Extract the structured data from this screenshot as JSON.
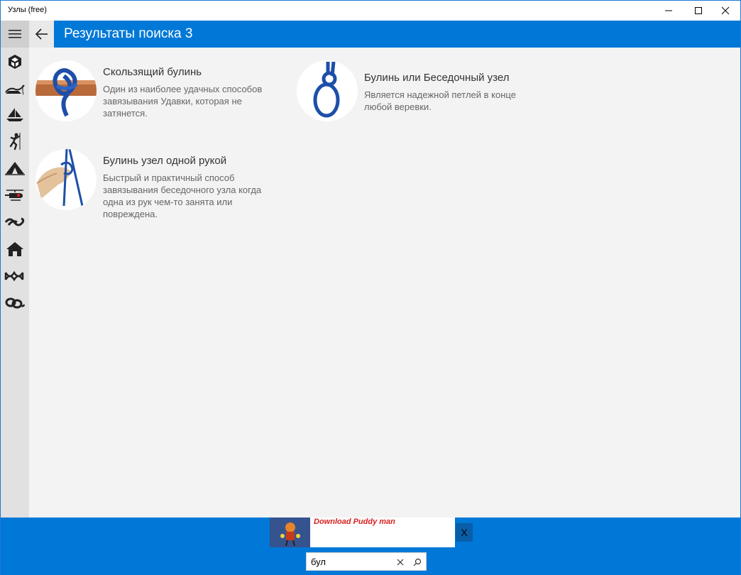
{
  "window": {
    "title": "Узлы (free)"
  },
  "header": {
    "title": "Результаты поиска 3"
  },
  "nav_icons": [
    "cube-knot-icon",
    "fishing-icon",
    "sailboat-icon",
    "climbing-icon",
    "tent-icon",
    "helicopter-rescue-icon",
    "rope-knot-icon",
    "house-icon",
    "decorative-knot-icon",
    "rope-coil-icon"
  ],
  "results": [
    {
      "title": "Скользящий булинь",
      "description": "Один из наиболее удачных способов завязывания Удавки, которая не затянется."
    },
    {
      "title": "Булинь или Беседочный узел",
      "description": "Является надежной петлей в конце любой веревки."
    },
    {
      "title": "Булинь узел одной рукой",
      "description": "Быстрый и практичный способ завязывания беседочного узла когда одна из рук чем-то занята или повреждена."
    }
  ],
  "ad": {
    "text": "Download Puddy man",
    "close_label": "X"
  },
  "search": {
    "value": "бул"
  },
  "colors": {
    "accent": "#0078d7",
    "rail": "#e1e1e1",
    "content_bg": "#f3f3f3",
    "rope_blue": "#1d4fa8"
  }
}
